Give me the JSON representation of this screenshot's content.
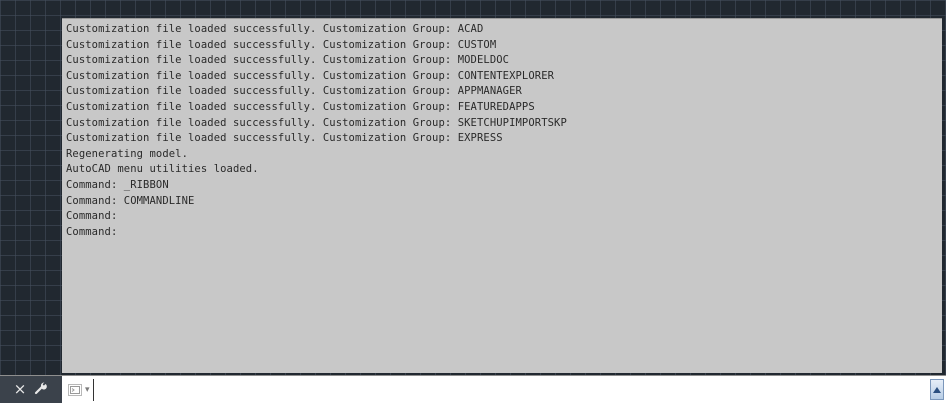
{
  "history": {
    "lines": [
      "Customization file loaded successfully. Customization Group: ACAD",
      "Customization file loaded successfully. Customization Group: CUSTOM",
      "Customization file loaded successfully. Customization Group: MODELDOC",
      "Customization file loaded successfully. Customization Group: CONTENTEXPLORER",
      "Customization file loaded successfully. Customization Group: APPMANAGER",
      "Customization file loaded successfully. Customization Group: FEATUREDAPPS",
      "Customization file loaded successfully. Customization Group: SKETCHUPIMPORTSKP",
      "Customization file loaded successfully. Customization Group: EXPRESS",
      "Regenerating model.",
      "AutoCAD menu utilities loaded.",
      "Command: _RIBBON",
      "Command: COMMANDLINE",
      "Command:",
      "Command:"
    ]
  },
  "command_bar": {
    "close_icon": "×",
    "customize_icon": "wrench-icon",
    "prompt_icon": "command-prompt-icon",
    "prompt_arrow": "▾",
    "input_value": "",
    "recent_icon": "up-arrow-icon"
  },
  "colors": {
    "drawing_background": "#212830",
    "history_background": "#c8c8c8",
    "history_text": "#2a2a2a",
    "tool_strip": "#3b424b"
  }
}
